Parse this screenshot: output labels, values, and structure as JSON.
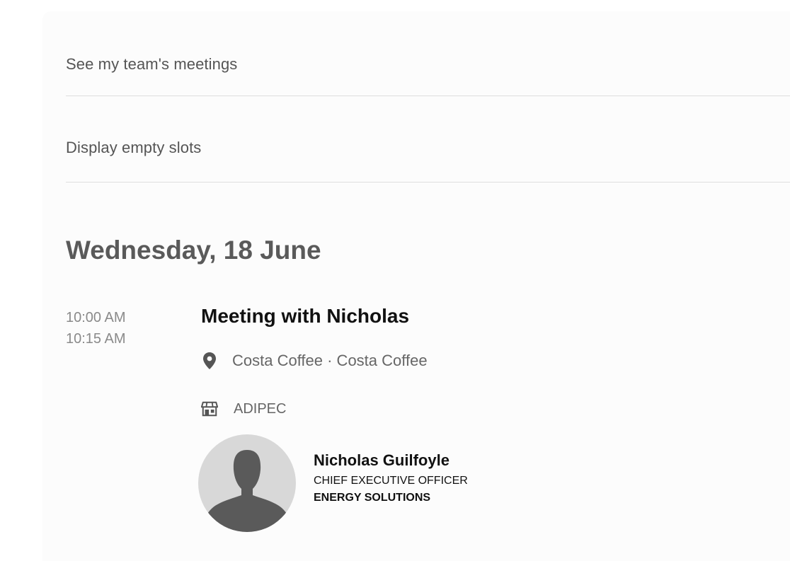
{
  "filters": {
    "team_meetings_label": "See my team's meetings",
    "empty_slots_label": "Display empty slots"
  },
  "schedule": {
    "date_heading": "Wednesday, 18 June",
    "meetings": [
      {
        "start_time": "10:00 AM",
        "end_time": "10:15 AM",
        "title": "Meeting with Nicholas",
        "location": "Costa Coffee · Costa Coffee",
        "location_icon": "map-pin-icon",
        "event": "ADIPEC",
        "event_icon": "booth-icon",
        "attendee": {
          "name": "Nicholas Guilfoyle",
          "role": "CHIEF EXECUTIVE OFFICER",
          "company": "ENERGY SOLUTIONS",
          "avatar_icon": "default-avatar-icon"
        }
      }
    ]
  },
  "colors": {
    "heading": "#5a5a5a",
    "title": "#111111",
    "muted_text": "#8a8a8a",
    "divider": "#dedede",
    "avatar_bg": "#d8d8d8",
    "avatar_figure": "#5a5a5a"
  }
}
